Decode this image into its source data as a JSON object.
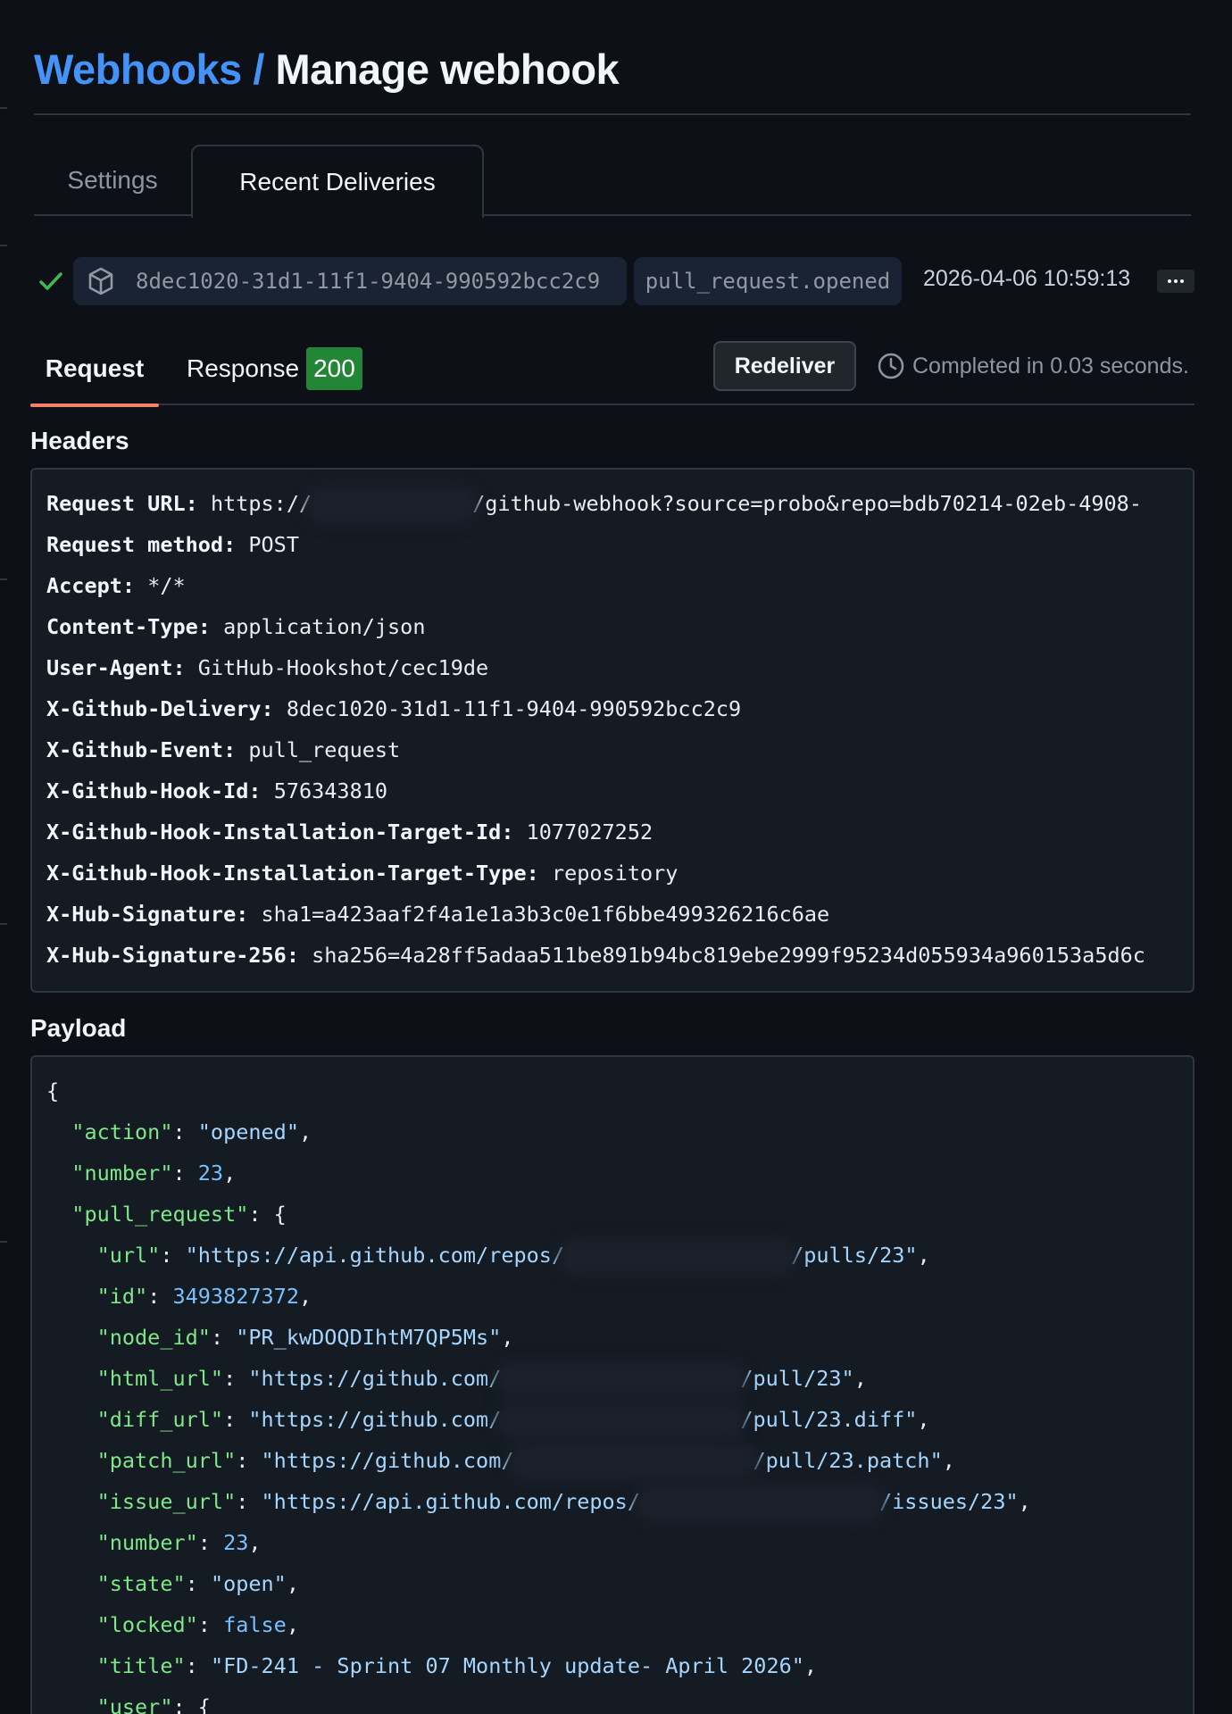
{
  "breadcrumb": {
    "parent": "Webhooks",
    "separator": "/",
    "current": "Manage webhook"
  },
  "tabs": [
    {
      "label": "Settings",
      "selected": false
    },
    {
      "label": "Recent Deliveries",
      "selected": true
    }
  ],
  "delivery": {
    "status": "success",
    "guid": "8dec1020-31d1-11f1-9404-990592bcc2c9",
    "event": "pull_request.opened",
    "timestamp": "2026-04-06 10:59:13",
    "more_icon": "kebab-horizontal-icon"
  },
  "subtabs": {
    "request_label": "Request",
    "response_label": "Response",
    "response_status": "200",
    "redeliver_label": "Redeliver",
    "completed_text": "Completed in 0.03 seconds."
  },
  "headers": {
    "heading": "Headers",
    "rows": [
      {
        "key": "Request URL:",
        "value": "https://",
        "value_after_redaction": "/github-webhook?source=probo&repo=bdb70214-02eb-4908-"
      },
      {
        "key": "Request method:",
        "value": "POST"
      },
      {
        "key": "Accept:",
        "value": "*/*"
      },
      {
        "key": "Content-Type:",
        "value": "application/json"
      },
      {
        "key": "User-Agent:",
        "value": "GitHub-Hookshot/cec19de"
      },
      {
        "key": "X-Github-Delivery:",
        "value": "8dec1020-31d1-11f1-9404-990592bcc2c9"
      },
      {
        "key": "X-Github-Event:",
        "value": "pull_request"
      },
      {
        "key": "X-Github-Hook-Id:",
        "value": "576343810"
      },
      {
        "key": "X-Github-Hook-Installation-Target-Id:",
        "value": "1077027252"
      },
      {
        "key": "X-Github-Hook-Installation-Target-Type:",
        "value": "repository"
      },
      {
        "key": "X-Hub-Signature:",
        "value": "sha1=a423aaf2f4a1e1a3b3c0e1f6bbe499326216c6ae"
      },
      {
        "key": "X-Hub-Signature-256:",
        "value": "sha256=4a28ff5adaa511be891b94bc819ebe2999f95234d055934a960153a5d6c"
      }
    ]
  },
  "payload": {
    "heading": "Payload",
    "open_brace": "{",
    "action": {
      "key": "\"action\"",
      "value": "\"opened\""
    },
    "number": {
      "key": "\"number\"",
      "value": "23"
    },
    "pull_request_key": "\"pull_request\"",
    "pr": {
      "url": {
        "key": "\"url\"",
        "prefix": "\"https://api.github.com/repos/",
        "suffix": "/pulls/23\""
      },
      "id": {
        "key": "\"id\"",
        "value": "3493827372"
      },
      "node_id": {
        "key": "\"node_id\"",
        "value": "\"PR_kwDOQDIhtM7QP5Ms\""
      },
      "html_url": {
        "key": "\"html_url\"",
        "prefix": "\"https://github.com/",
        "suffix": "/pull/23\""
      },
      "diff_url": {
        "key": "\"diff_url\"",
        "prefix": "\"https://github.com/",
        "suffix": "/pull/23.diff\""
      },
      "patch_url": {
        "key": "\"patch_url\"",
        "prefix": "\"https://github.com/",
        "suffix": "/pull/23.patch\""
      },
      "issue_url": {
        "key": "\"issue_url\"",
        "prefix": "\"https://api.github.com/repos/",
        "suffix": "/issues/23\""
      },
      "number": {
        "key": "\"number\"",
        "value": "23"
      },
      "state": {
        "key": "\"state\"",
        "value": "\"open\""
      },
      "locked": {
        "key": "\"locked\"",
        "value": "false"
      },
      "title": {
        "key": "\"title\"",
        "value": "\"FD-241 - Sprint 07 Monthly update- April 2026\""
      },
      "user_key": "\"user\""
    }
  },
  "colors": {
    "background": "#0d1117",
    "link": "#4493f8",
    "success": "#3fb950",
    "badge": "#238636",
    "tab_underline": "#f78166",
    "json_key": "#7ee787",
    "json_string": "#a5d6ff",
    "json_number": "#79c0ff"
  }
}
